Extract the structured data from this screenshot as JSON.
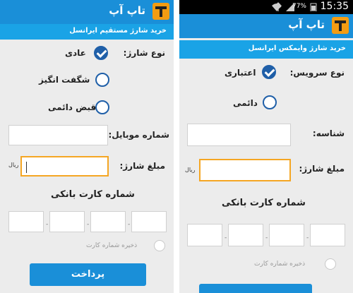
{
  "left_screen": {
    "app_title": "تاپ آپ",
    "subtitle": "خرید شارژ مستقیم ایرانسل",
    "charge_type_label": "نوع شارژ:",
    "options": [
      {
        "label": "عادی",
        "selected": true
      },
      {
        "label": "شگفت انگیز",
        "selected": false
      },
      {
        "label": "قبض دائمی",
        "selected": false
      }
    ],
    "mobile_label": "شماره موبایل:",
    "mobile_value": "",
    "amount_label": "مبلغ شارژ:",
    "amount_unit": "ریال",
    "amount_value": "",
    "card_title": "شماره کارت بانکی",
    "card_sep": "-",
    "save_label": "ذخیره شماره کارت",
    "pay_button": "پرداخت"
  },
  "right_screen": {
    "status_time": "15:35",
    "status_battery": "77%",
    "app_title": "تاپ آپ",
    "subtitle": "خرید شارژ وایمکس ایرانسل",
    "service_type_label": "نوع سرویس:",
    "options": [
      {
        "label": "اعتباری",
        "selected": true
      },
      {
        "label": "دائمی",
        "selected": false
      }
    ],
    "id_label": "شناسه:",
    "id_value": "",
    "amount_label": "مبلغ شارژ:",
    "amount_unit": "ریال",
    "amount_value": "",
    "card_title": "شماره کارت بانکی",
    "card_sep": "-",
    "save_label": "ذخیره شماره کارت"
  },
  "colors": {
    "appbar": "#1a8fd8",
    "subbar": "#1aa3e6",
    "accent_focus": "#f5a623",
    "radio": "#1f5fa8"
  }
}
